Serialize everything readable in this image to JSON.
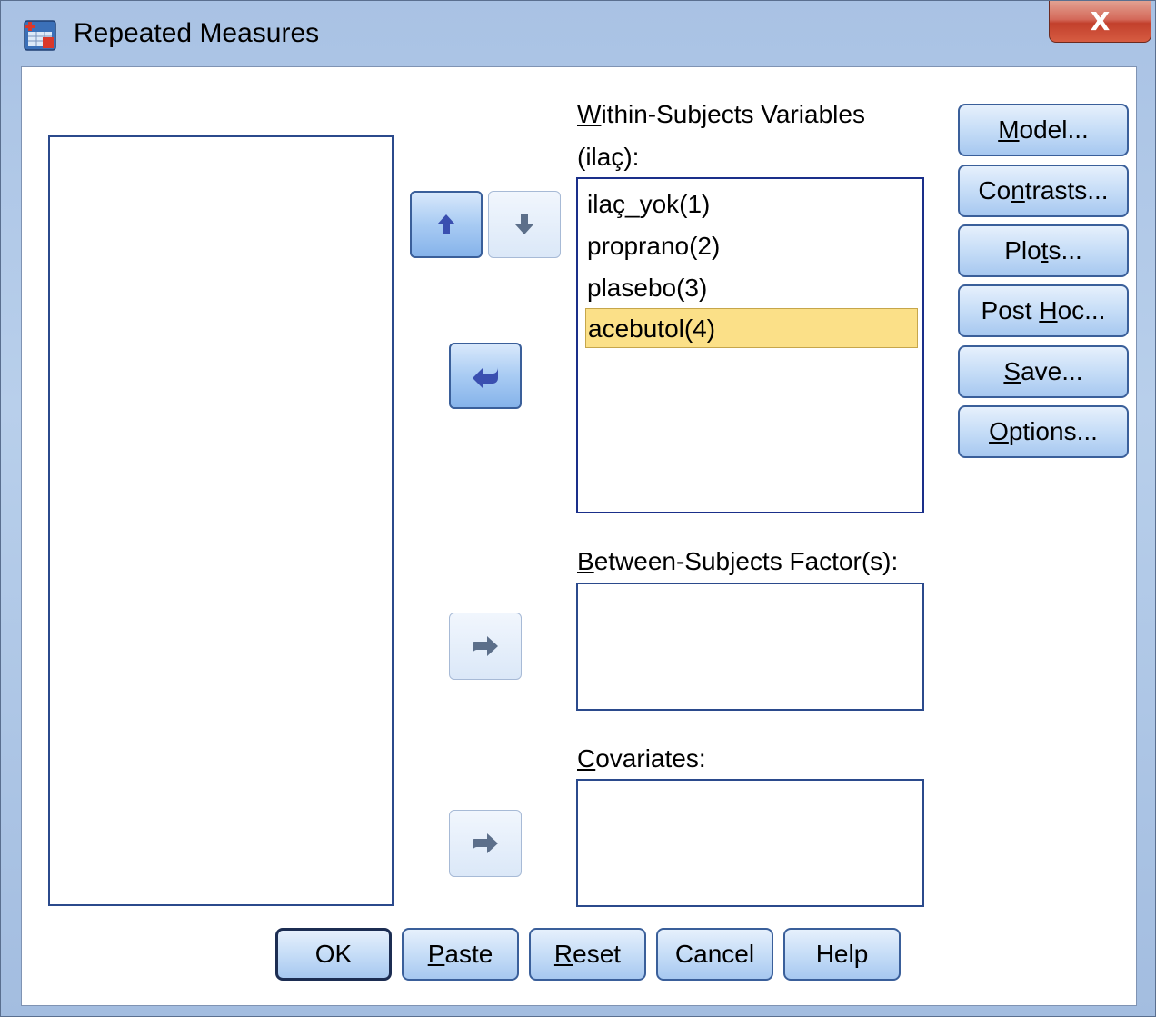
{
  "window": {
    "title": "Repeated Measures",
    "close_glyph": "X"
  },
  "within_subjects": {
    "label_first_char": "W",
    "label_rest": "ithin-Subjects Variables",
    "label_line2": "(ilaç):",
    "items": [
      {
        "label": "ilaç_yok(1)",
        "selected": false
      },
      {
        "label": "proprano(2)",
        "selected": false
      },
      {
        "label": "plasebo(3)",
        "selected": false
      },
      {
        "label": "acebutol(4)",
        "selected": true
      }
    ]
  },
  "between_subjects": {
    "label_first_char": "B",
    "label_rest": "etween-Subjects Factor(s):"
  },
  "covariates": {
    "label_first_char": "C",
    "label_rest": "ovariates:"
  },
  "side_buttons": {
    "model": {
      "pre": "",
      "u": "M",
      "post": "odel..."
    },
    "contrasts": {
      "pre": "Co",
      "u": "n",
      "post": "trasts..."
    },
    "plots": {
      "pre": "Plo",
      "u": "t",
      "post": "s..."
    },
    "post_hoc": {
      "pre": "Post ",
      "u": "H",
      "post": "oc..."
    },
    "save": {
      "pre": "",
      "u": "S",
      "post": "ave..."
    },
    "options": {
      "pre": "",
      "u": "O",
      "post": "ptions..."
    }
  },
  "bottom_buttons": {
    "ok": {
      "pre": "OK",
      "u": "",
      "post": ""
    },
    "paste": {
      "pre": "",
      "u": "P",
      "post": "aste"
    },
    "reset": {
      "pre": "",
      "u": "R",
      "post": "eset"
    },
    "cancel": {
      "pre": "Cancel",
      "u": "",
      "post": ""
    },
    "help": {
      "pre": "Help",
      "u": "",
      "post": ""
    }
  },
  "icons": {
    "up": "up-arrow-icon",
    "down": "down-arrow-icon",
    "move_back": "move-back-arrow-icon",
    "move_right": "move-right-arrow-icon"
  },
  "colors": {
    "selected_item_bg": "#fbe088",
    "listbox_border": "#1a2f8a",
    "button_border": "#3a5f9a"
  }
}
